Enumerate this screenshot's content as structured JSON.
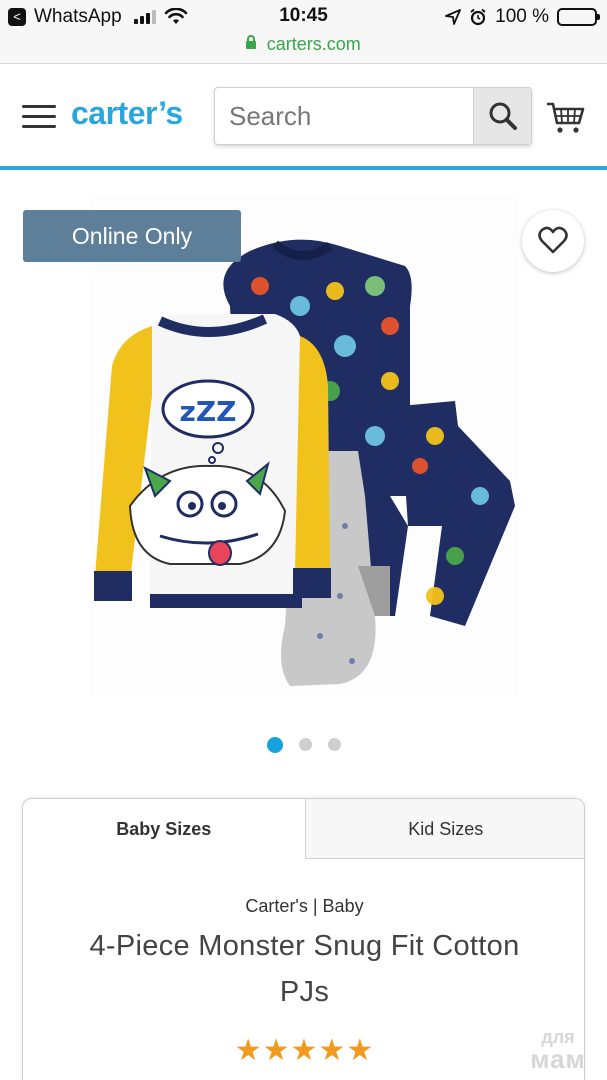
{
  "status_bar": {
    "app_name": "WhatsApp",
    "back_glyph": "<",
    "time": "10:45",
    "battery": "100 %",
    "battery_level": 1.0,
    "icons": [
      "signal-icon",
      "wifi-icon",
      "location-icon",
      "alarm-icon",
      "battery-icon"
    ]
  },
  "browser": {
    "url": "carters.com",
    "secure_color": "#3aa54a"
  },
  "header": {
    "logo": "carter’s",
    "search_placeholder": "Search",
    "icons": [
      "menu-icon",
      "search-icon",
      "cart-icon"
    ],
    "accent_color": "#2aa7de"
  },
  "gallery": {
    "badge": "Online Only",
    "badge_color": "#5e7f9a",
    "active_slide": 1,
    "slide_count": 3,
    "dot_active_color": "#14a3dc",
    "image_caption_note": "",
    "shirt_text": "zZZ"
  },
  "product": {
    "tabs": [
      {
        "label": "Baby Sizes",
        "active": true
      },
      {
        "label": "Kid Sizes",
        "active": false
      }
    ],
    "brand": "Carter's | Baby",
    "title": "4-Piece Monster Snug Fit Cotton PJs",
    "rating_stars": "★★★★★",
    "rating": 5,
    "star_color": "#f29a1c"
  },
  "watermark": {
    "line1": "для",
    "line2": "мам"
  }
}
